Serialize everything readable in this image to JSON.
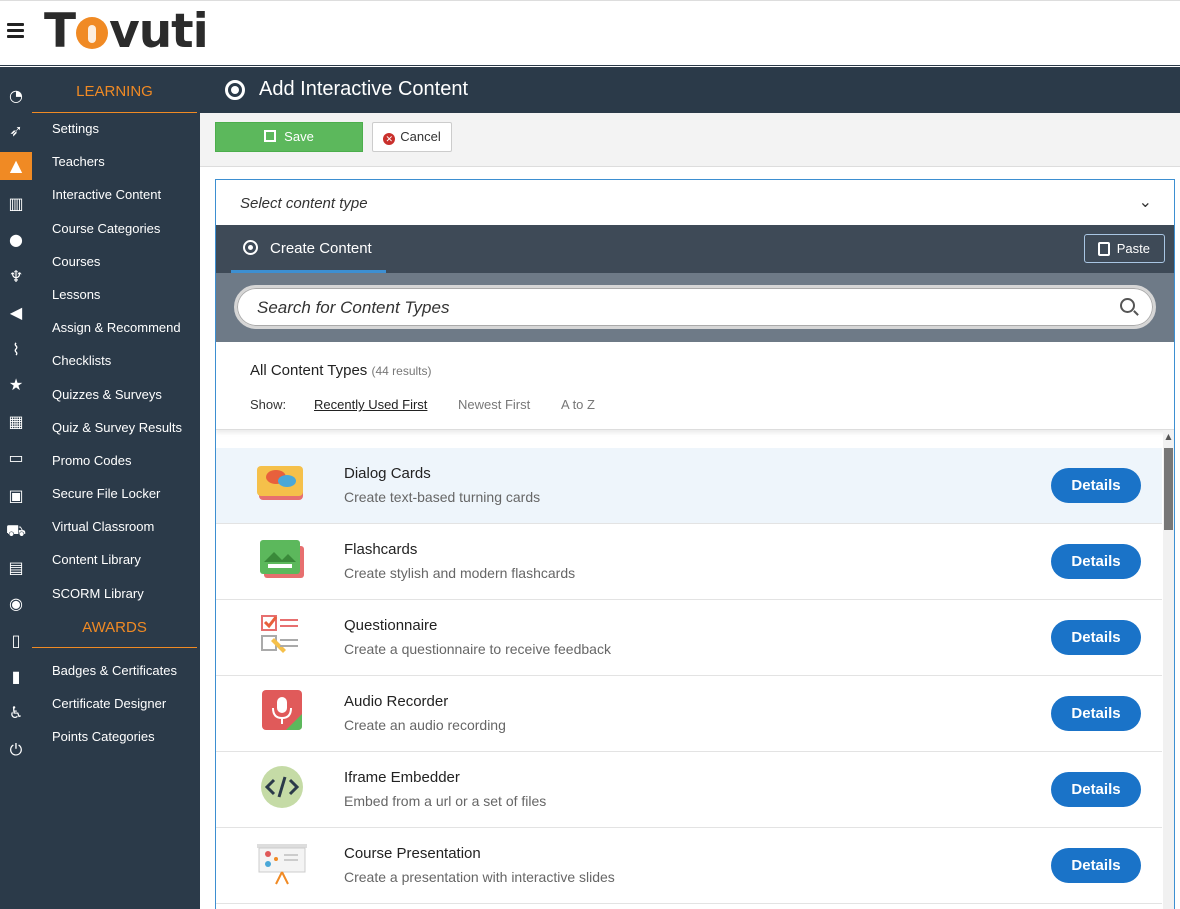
{
  "brand": {
    "logo_text_left": "T",
    "logo_text_right": "vuti",
    "accent": "#f08a24",
    "nav_bg": "#2b3a49"
  },
  "sidebar_icons": [
    "dashboard-icon",
    "rocket-icon",
    "graduation-cap-icon",
    "bar-chart-icon",
    "users-icon",
    "trophy-icon",
    "megaphone-icon",
    "feed-icon",
    "star-icon",
    "table-icon",
    "credit-card-icon",
    "id-badge-icon",
    "cart-icon",
    "calendar-icon",
    "comments-icon",
    "file-icon",
    "address-book-icon",
    "accessibility-icon",
    "power-icon"
  ],
  "menu": {
    "learning_heading": "LEARNING",
    "learning_items": [
      "Settings",
      "Teachers",
      "Interactive Content",
      "Course Categories",
      "Courses",
      "Lessons",
      "Assign & Recommend",
      "Checklists",
      "Quizzes & Surveys",
      "Quiz & Survey Results",
      "Promo Codes",
      "Secure File Locker",
      "Virtual Classroom",
      "Content Library",
      "SCORM Library"
    ],
    "awards_heading": "AWARDS",
    "awards_items": [
      "Badges & Certificates",
      "Certificate Designer",
      "Points Categories"
    ]
  },
  "page": {
    "title": "Add Interactive Content"
  },
  "toolbar": {
    "save_label": "Save",
    "cancel_label": "Cancel"
  },
  "content": {
    "select_label": "Select content type",
    "tab_label": "Create Content",
    "paste_label": "Paste",
    "search_placeholder": "Search for Content Types",
    "list_heading": "All Content Types",
    "result_count": "(44 results)",
    "show_label": "Show:",
    "sort_options": [
      "Recently Used First",
      "Newest First",
      "A to Z"
    ],
    "sort_selected": "Recently Used First",
    "details_label": "Details",
    "items": [
      {
        "name": "Dialog Cards",
        "desc": "Create text-based turning cards",
        "icon": "dialog-cards-icon"
      },
      {
        "name": "Flashcards",
        "desc": "Create stylish and modern flashcards",
        "icon": "flashcards-icon"
      },
      {
        "name": "Questionnaire",
        "desc": "Create a questionnaire to receive feedback",
        "icon": "questionnaire-icon"
      },
      {
        "name": "Audio Recorder",
        "desc": "Create an audio recording",
        "icon": "audio-recorder-icon"
      },
      {
        "name": "Iframe Embedder",
        "desc": "Embed from a url or a set of files",
        "icon": "iframe-embedder-icon"
      },
      {
        "name": "Course Presentation",
        "desc": "Create a presentation with interactive slides",
        "icon": "course-presentation-icon"
      }
    ]
  }
}
